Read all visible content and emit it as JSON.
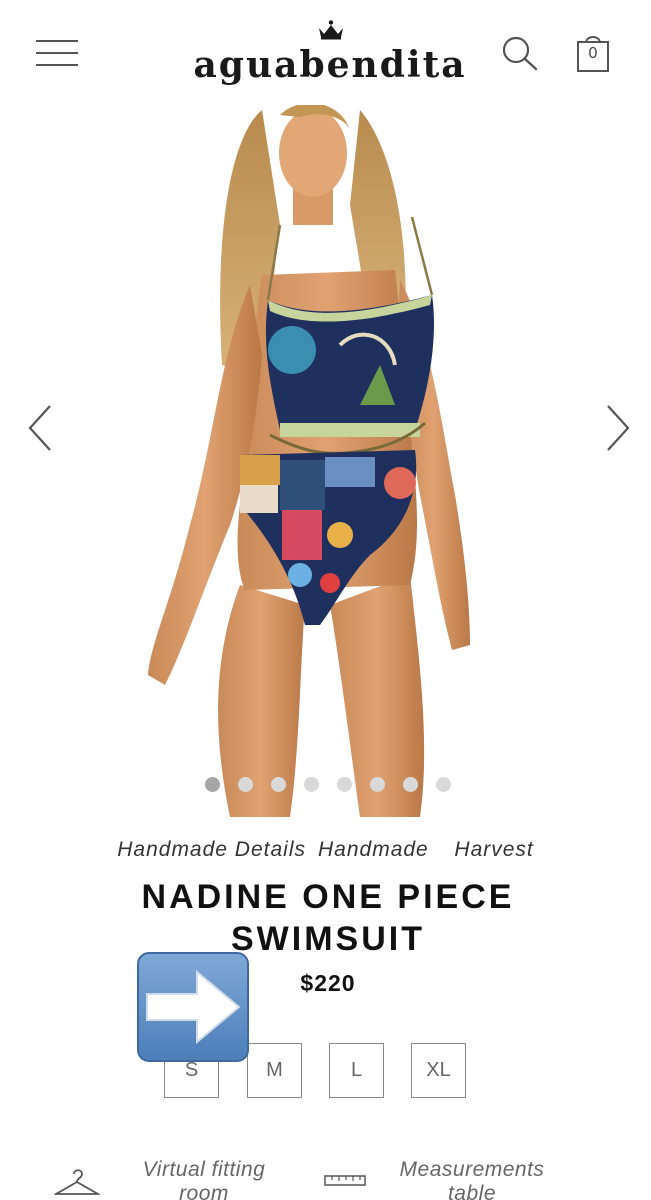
{
  "header": {
    "logo": "aguabendita",
    "cart_count": "0"
  },
  "gallery": {
    "image_count": 8,
    "active_index": 0
  },
  "product": {
    "collections": [
      "Handmade Details",
      "Handmade",
      "Harvest"
    ],
    "title": "NADINE ONE PIECE SWIMSUIT",
    "price": "$220",
    "sizes": [
      "S",
      "M",
      "L",
      "XL"
    ]
  },
  "links": {
    "virtual_fitting": "Virtual fitting room",
    "measurements": "Measurements table"
  },
  "colors": {
    "accent_arrow": "#5b8bc4",
    "text": "#111111",
    "muted": "#666666"
  }
}
